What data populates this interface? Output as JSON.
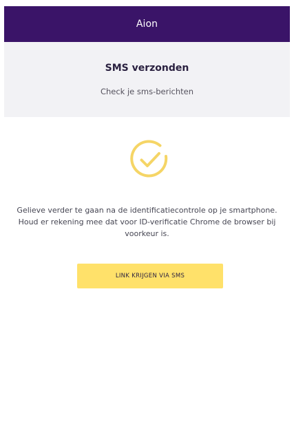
{
  "header": {
    "title": "Aion",
    "background_color": "#3a1468"
  },
  "status_panel": {
    "title": "SMS verzonden",
    "subtitle": "Check je sms-berichten"
  },
  "success_icon": {
    "name": "check-circle-icon",
    "color": "#f5d566"
  },
  "message": {
    "line_1": "Gelieve verder te gaan na de identificatiecontrole op je smartphone.",
    "line_2": "Houd er rekening mee dat voor ID-verificatie Chrome de browser bij",
    "line_3": "voorkeur is."
  },
  "actions": {
    "sms_link_label": "LINK KRIJGEN VIA SMS",
    "button_color": "#ffe16a"
  }
}
